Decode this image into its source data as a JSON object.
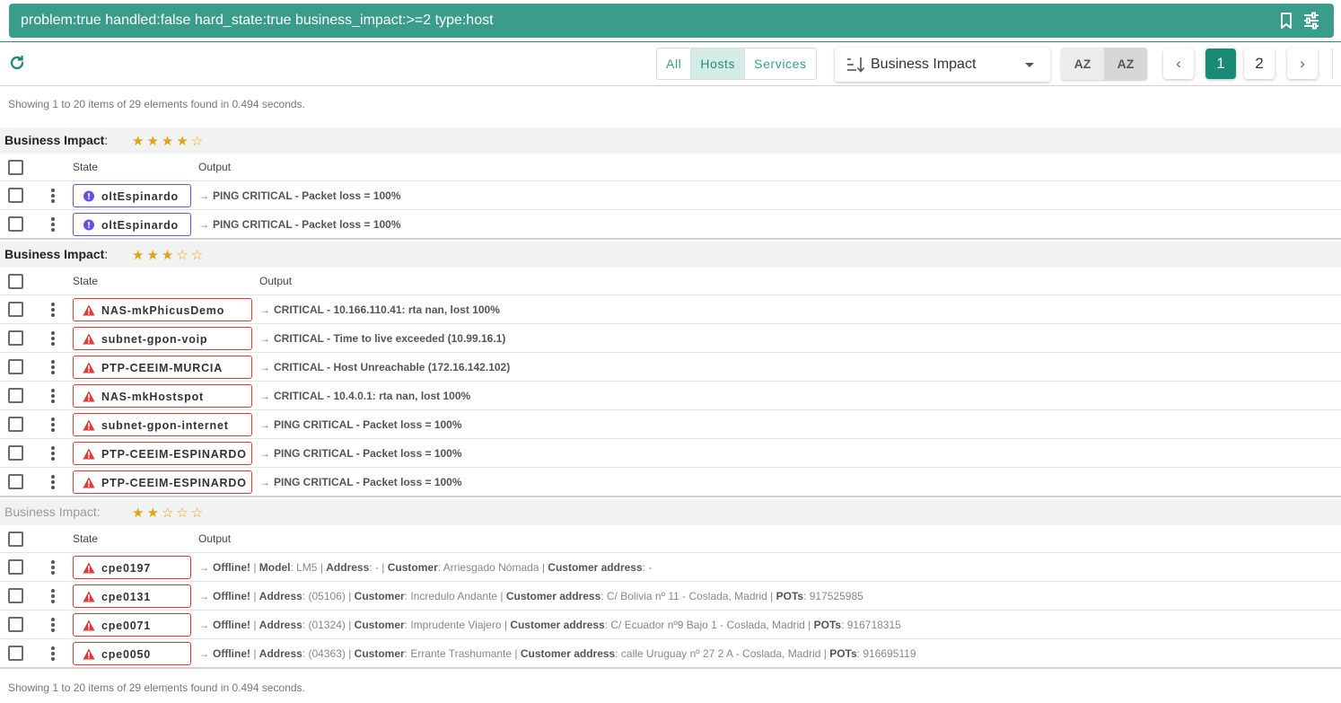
{
  "search": {
    "query": "problem:true handled:false hard_state:true business_impact:>=2 type:host"
  },
  "toolbar": {
    "filters": [
      "All",
      "Hosts",
      "Services"
    ],
    "active_filter": "Hosts",
    "sort_label": "Business Impact",
    "sort_asc": "AZ",
    "sort_desc": "AZ",
    "pages": [
      "1",
      "2"
    ],
    "current_page": "1"
  },
  "info_top": "Showing 1 to 20 items of 29 elements found in 0.494 seconds.",
  "info_bottom": "Showing 1 to 20 items of 29 elements found in 0.494 seconds.",
  "columns": {
    "state": "State",
    "output": "Output"
  },
  "groups": [
    {
      "label": "Business Impact",
      "colon": ":",
      "stars": "★★★★☆",
      "rows": [
        {
          "name": "oltEspinardo",
          "state": "unreachable",
          "output": "PING CRITICAL - Packet loss = 100%"
        },
        {
          "name": "oltEspinardo",
          "state": "unreachable",
          "output": "PING CRITICAL - Packet loss = 100%"
        }
      ]
    },
    {
      "label": "Business Impact",
      "colon": ":",
      "stars": "★★★☆☆",
      "rows": [
        {
          "name": "NAS-mkPhicusDemo",
          "state": "down",
          "output": "CRITICAL - 10.166.110.41: rta nan, lost 100%"
        },
        {
          "name": "subnet-gpon-voip",
          "state": "down",
          "output": "CRITICAL - Time to live exceeded (10.99.16.1)"
        },
        {
          "name": "PTP-CEEIM-MURCIA",
          "state": "down",
          "output": "CRITICAL - Host Unreachable (172.16.142.102)"
        },
        {
          "name": "NAS-mkHostspot",
          "state": "down",
          "output": "CRITICAL - 10.4.0.1: rta nan, lost 100%"
        },
        {
          "name": "subnet-gpon-internet",
          "state": "down",
          "output": "PING CRITICAL - Packet loss = 100%"
        },
        {
          "name": "PTP-CEEIM-ESPINARDO",
          "state": "down",
          "output": "PING CRITICAL - Packet loss = 100%"
        },
        {
          "name": "PTP-CEEIM-ESPINARDO",
          "state": "down",
          "output": "PING CRITICAL - Packet loss = 100%"
        }
      ]
    },
    {
      "label": "Business Impact",
      "colon": ":",
      "stars": "★★☆☆☆",
      "rows": [
        {
          "name": "cpe0197",
          "state": "down",
          "parts": [
            [
              "b",
              "Offline!"
            ],
            [
              "p",
              " | "
            ],
            [
              "b",
              "Model"
            ],
            [
              "p",
              ": LM5 | "
            ],
            [
              "b",
              "Address"
            ],
            [
              "p",
              ": - | "
            ],
            [
              "b",
              "Customer"
            ],
            [
              "p",
              ": Arriesgado Nómada | "
            ],
            [
              "b",
              "Customer address"
            ],
            [
              "p",
              ": -"
            ]
          ]
        },
        {
          "name": "cpe0131",
          "state": "down",
          "parts": [
            [
              "b",
              "Offline!"
            ],
            [
              "p",
              " | "
            ],
            [
              "b",
              "Address"
            ],
            [
              "p",
              ": (05106) | "
            ],
            [
              "b",
              "Customer"
            ],
            [
              "p",
              ": Incredulo Andante | "
            ],
            [
              "b",
              "Customer address"
            ],
            [
              "p",
              ": C/ Bolivia nº 11 - Coslada, Madrid | "
            ],
            [
              "b",
              "POTs"
            ],
            [
              "p",
              ": 917525985"
            ]
          ]
        },
        {
          "name": "cpe0071",
          "state": "down",
          "parts": [
            [
              "b",
              "Offline!"
            ],
            [
              "p",
              " | "
            ],
            [
              "b",
              "Address"
            ],
            [
              "p",
              ": (01324) | "
            ],
            [
              "b",
              "Customer"
            ],
            [
              "p",
              ": Imprudente Viajero | "
            ],
            [
              "b",
              "Customer address"
            ],
            [
              "p",
              ": C/ Ecuador nº9 Bajo 1 - Coslada, Madrid | "
            ],
            [
              "b",
              "POTs"
            ],
            [
              "p",
              ": 916718315"
            ]
          ]
        },
        {
          "name": "cpe0050",
          "state": "down",
          "parts": [
            [
              "b",
              "Offline!"
            ],
            [
              "p",
              " | "
            ],
            [
              "b",
              "Address"
            ],
            [
              "p",
              ": (04363) | "
            ],
            [
              "b",
              "Customer"
            ],
            [
              "p",
              ": Errante Trashumante | "
            ],
            [
              "b",
              "Customer address"
            ],
            [
              "p",
              ": calle Uruguay nº 27 2 A - Coslada, Madrid | "
            ],
            [
              "b",
              "POTs"
            ],
            [
              "p",
              ": 916695119"
            ]
          ]
        }
      ]
    }
  ],
  "colors": {
    "accent": "#3a9d8b",
    "down": "#e23a3a",
    "unreachable": "#6a4fe0",
    "star": "#e0a419"
  }
}
